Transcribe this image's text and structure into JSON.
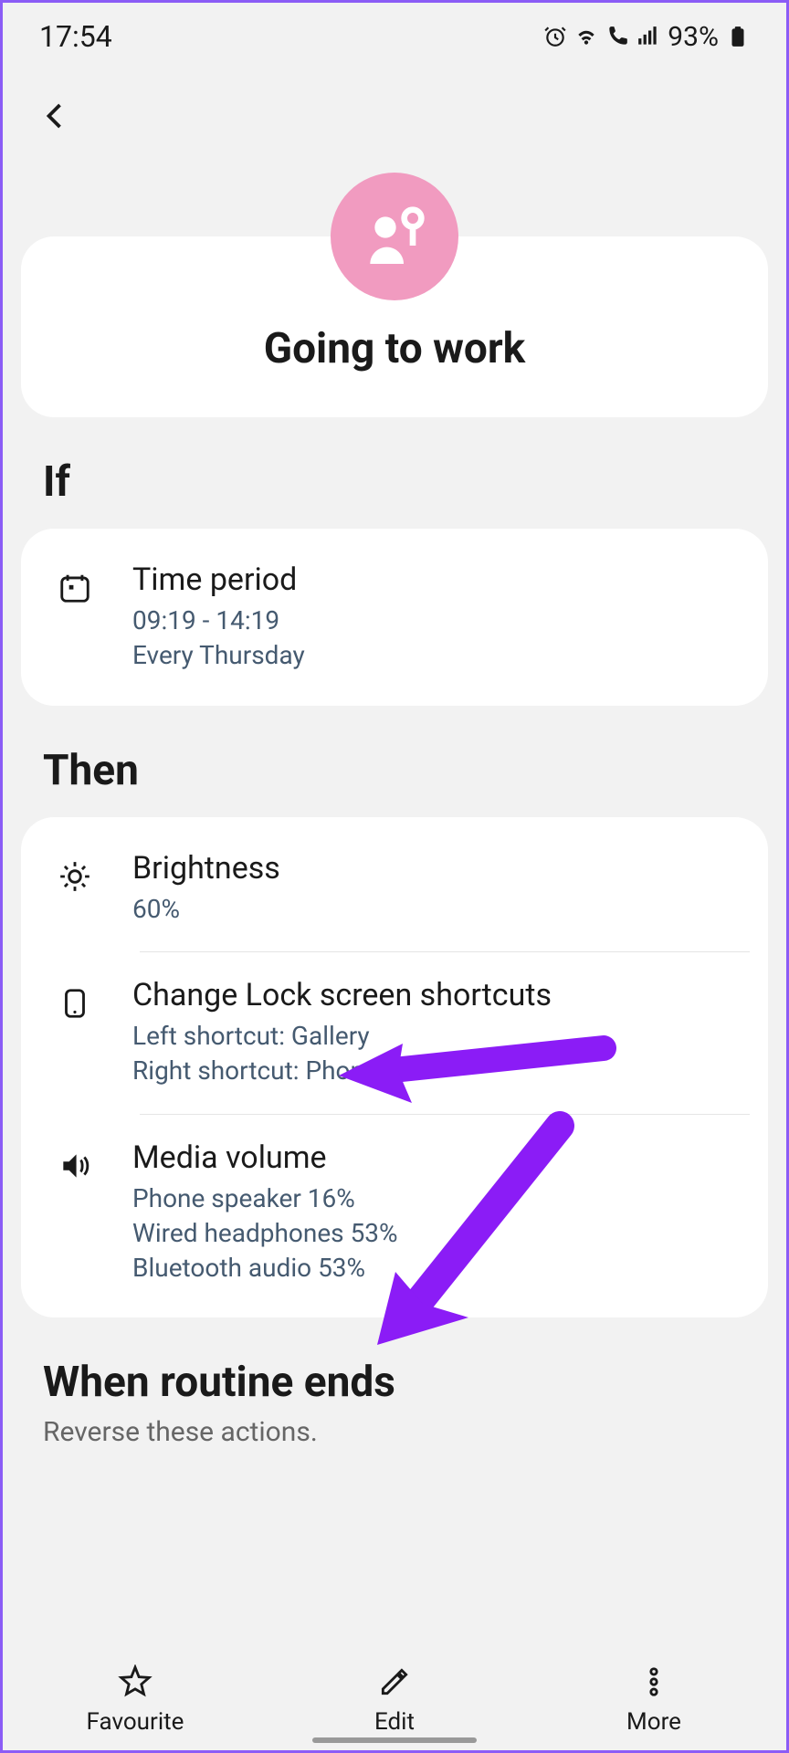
{
  "status": {
    "time": "17:54",
    "battery_text": "93%"
  },
  "routine": {
    "title": "Going to work"
  },
  "sections": {
    "if_label": "If",
    "then_label": "Then",
    "ends_label": "When routine ends",
    "ends_sub": "Reverse these actions."
  },
  "if_items": [
    {
      "title": "Time period",
      "time": "09:19 - 14:19",
      "days": "Every Thursday"
    }
  ],
  "then_items": [
    {
      "title": "Brightness",
      "detail1": "60%"
    },
    {
      "title": "Change Lock screen shortcuts",
      "detail1": "Left shortcut: Gallery",
      "detail2": "Right shortcut: Phone"
    },
    {
      "title": "Media volume",
      "detail1": "Phone speaker 16%",
      "detail2": "Wired headphones 53%",
      "detail3": "Bluetooth audio 53%"
    }
  ],
  "bottom": {
    "favourite": "Favourite",
    "edit": "Edit",
    "more": "More"
  }
}
